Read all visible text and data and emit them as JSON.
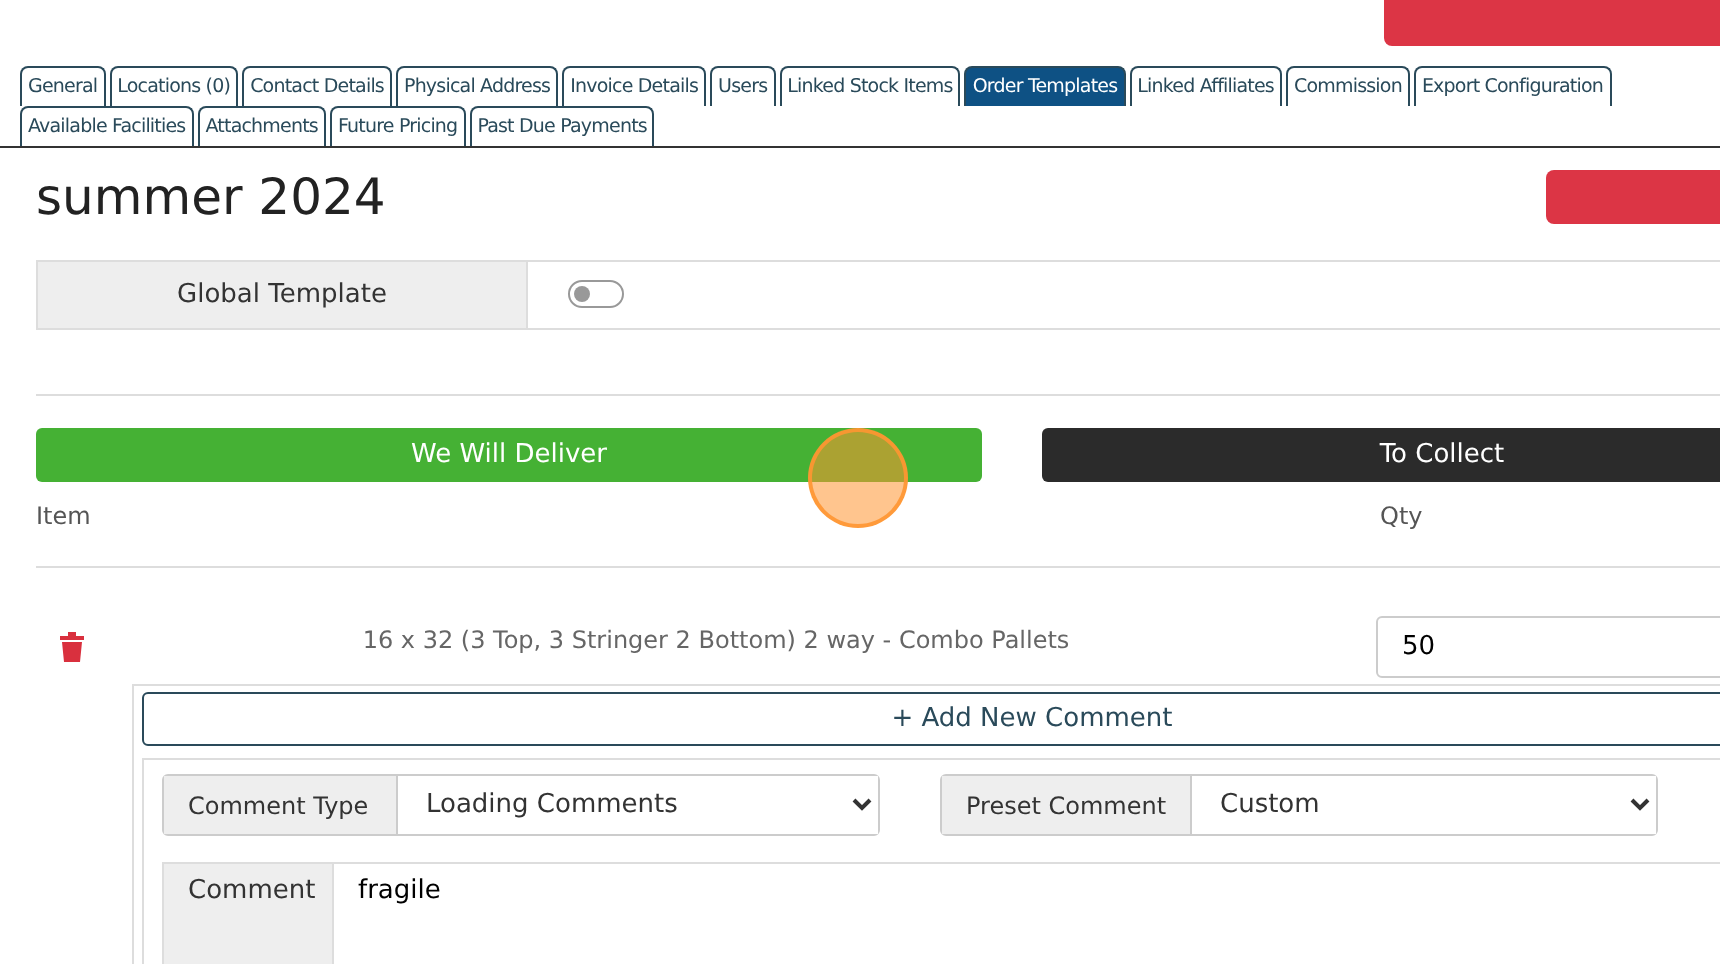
{
  "tabs": [
    {
      "label": "General",
      "selected": false
    },
    {
      "label": "Locations (0)",
      "selected": false
    },
    {
      "label": "Contact Details",
      "selected": false
    },
    {
      "label": "Physical Address",
      "selected": false
    },
    {
      "label": "Invoice Details",
      "selected": false
    },
    {
      "label": "Users",
      "selected": false
    },
    {
      "label": "Linked Stock Items",
      "selected": false
    },
    {
      "label": "Order Templates",
      "selected": true
    },
    {
      "label": "Linked Affiliates",
      "selected": false
    },
    {
      "label": "Commission",
      "selected": false
    },
    {
      "label": "Export Configuration",
      "selected": false
    },
    {
      "label": "Available Facilities",
      "selected": false
    },
    {
      "label": "Attachments",
      "selected": false
    },
    {
      "label": "Future Pricing",
      "selected": false
    },
    {
      "label": "Past Due Payments",
      "selected": false
    }
  ],
  "template": {
    "title": "summer 2024",
    "global_template": {
      "label": "Global Template",
      "on": false
    }
  },
  "delivery_options": [
    {
      "label": "We Will Deliver",
      "selected": true
    },
    {
      "label": "To Collect",
      "selected": false
    }
  ],
  "table": {
    "columns": [
      "Item",
      "Qty"
    ],
    "rows": [
      {
        "item": "16 x 32 (3 Top, 3 Stringer 2 Bottom) 2 way - Combo Pallets",
        "qty": "50",
        "add_comment": "+ Add New Comment",
        "comment": {
          "type_label": "Comment Type",
          "type_value": "Loading Comments",
          "preset_label": "Preset Comment",
          "preset_value": "Custom",
          "comment_label": "Comment",
          "comment_value": "fragile"
        }
      }
    ]
  }
}
